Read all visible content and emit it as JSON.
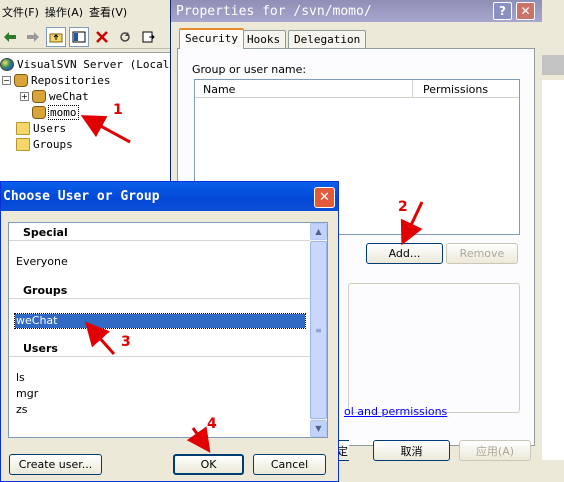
{
  "mmc": {
    "menu": [
      "文件(F)",
      "操作(A)",
      "查看(V)"
    ],
    "tree": {
      "root": "VisualSVN Server (Local)",
      "repositories": "Repositories",
      "repo_1": "weChat",
      "repo_2": "momo",
      "users": "Users",
      "groups": "Groups"
    }
  },
  "properties_dialog": {
    "title": "Properties for /svn/momo/",
    "tabs": [
      "Security",
      "Hooks",
      "Delegation"
    ],
    "group_label": "Group or user name:",
    "columns": [
      "Name",
      "Permissions"
    ],
    "add_label": "Add...",
    "remove_label": "Remove",
    "perm_link_text": "ol and permissions",
    "ok_fragment": "定",
    "cancel_label": "取消",
    "apply_label": "应用(A)"
  },
  "choose_dialog": {
    "title": "Choose User or Group",
    "sections": [
      {
        "header": "Special",
        "items": [
          "Everyone"
        ]
      },
      {
        "header": "Groups",
        "items": [
          "weChat"
        ]
      },
      {
        "header": "Users",
        "items": [
          "ls",
          "mgr",
          "zs"
        ]
      }
    ],
    "selected_item": "weChat",
    "create_user_label": "Create user...",
    "ok_label": "OK",
    "cancel_label": "Cancel"
  },
  "annotations": [
    "1",
    "2",
    "3",
    "4"
  ],
  "colors": {
    "annotation_red": "#e00000",
    "selection_blue": "#316ac5",
    "title_blue": "#0347d6"
  }
}
